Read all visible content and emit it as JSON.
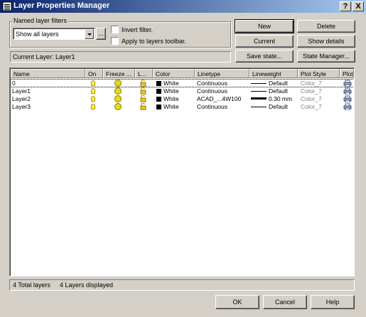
{
  "window": {
    "title": "Layer Properties Manager",
    "help_btn": "?",
    "close_btn": "X"
  },
  "filters": {
    "group_label": "Named layer filters",
    "selected": "Show all layers",
    "browse_label": "...",
    "invert_label": "Invert filter.",
    "apply_label": "Apply to layers toolbar.",
    "invert_checked": false,
    "apply_checked": false
  },
  "buttons": {
    "new": "New",
    "delete": "Delete",
    "current": "Current",
    "show_details": "Show details",
    "save_state": "Save state...",
    "state_manager": "State Manager...",
    "ok": "OK",
    "cancel": "Cancel",
    "help": "Help"
  },
  "current_layer": "Current Layer:  Layer1",
  "columns": [
    "Name",
    "On",
    "Freeze ...",
    "L...",
    "Color",
    "Linetype",
    "Lineweight",
    "Plot Style",
    "Plot"
  ],
  "layers": [
    {
      "name": "0",
      "on": true,
      "frozen": false,
      "locked": false,
      "color": "White",
      "linetype": "Continuous",
      "lineweight": "Default",
      "plot_style": "Color_7",
      "plot": true,
      "lw_thick": false
    },
    {
      "name": "Layer1",
      "on": true,
      "frozen": false,
      "locked": false,
      "color": "White",
      "linetype": "Continuous",
      "lineweight": "Default",
      "plot_style": "Color_7",
      "plot": true,
      "lw_thick": false
    },
    {
      "name": "Layer2",
      "on": true,
      "frozen": false,
      "locked": false,
      "color": "White",
      "linetype": "ACAD_...4W100",
      "lineweight": "0.30 mm",
      "plot_style": "Color_7",
      "plot": true,
      "lw_thick": true
    },
    {
      "name": "Layer3",
      "on": true,
      "frozen": false,
      "locked": false,
      "color": "White",
      "linetype": "Continuous",
      "lineweight": "Default",
      "plot_style": "Color_7",
      "plot": true,
      "lw_thick": false
    }
  ],
  "status": {
    "total": "4 Total layers",
    "displayed": "4 Layers displayed"
  },
  "colors": {
    "title_start": "#0a246a",
    "title_end": "#a6caf0",
    "face": "#d4d0c8",
    "bulb": "#ffef5a",
    "sun": "#e8d820"
  }
}
